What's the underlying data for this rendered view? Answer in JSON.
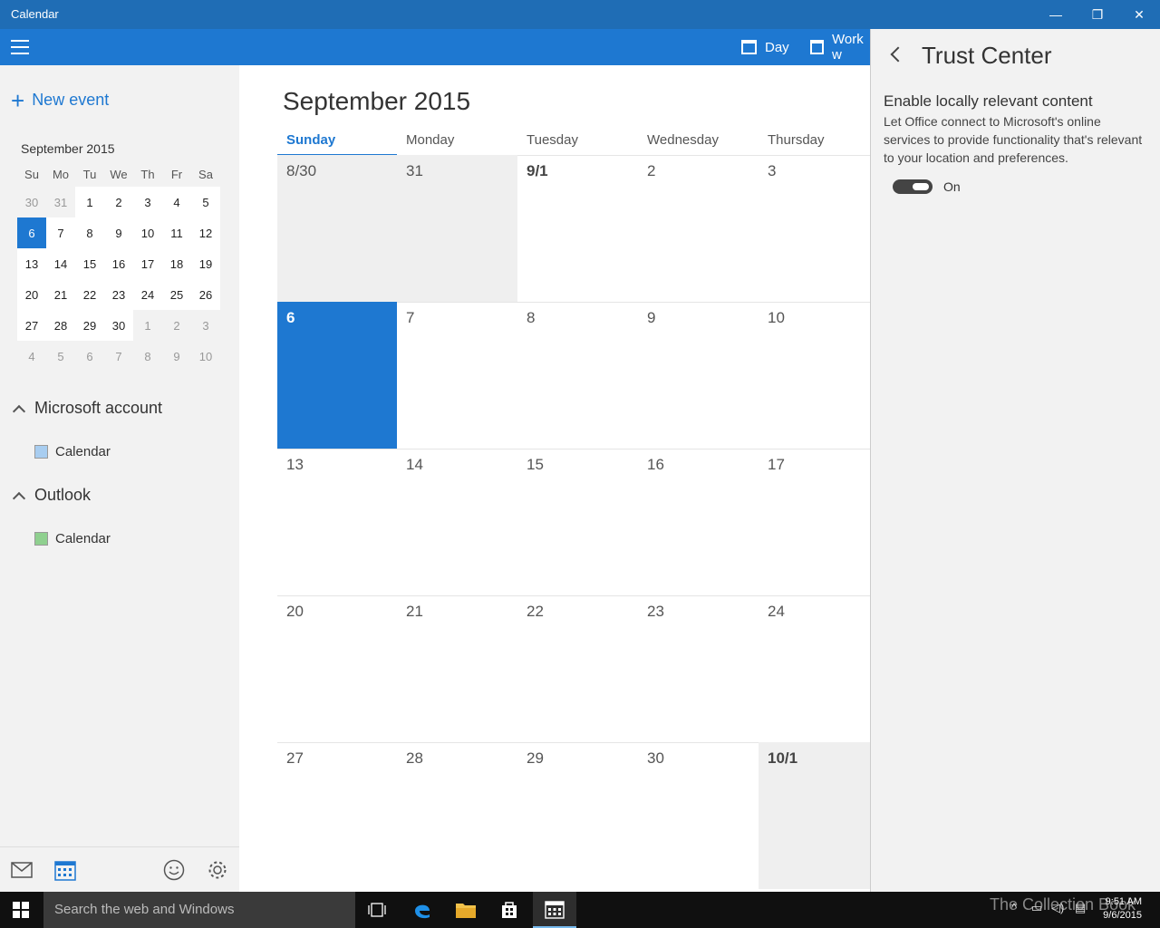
{
  "window": {
    "title": "Calendar",
    "minimize": "—",
    "restore": "❐",
    "close": "✕"
  },
  "toolbar": {
    "day_label": "Day",
    "workweek_label": "Work w"
  },
  "sidebar": {
    "new_event": "New event",
    "mini_month": "September 2015",
    "mini_headers": [
      "Su",
      "Mo",
      "Tu",
      "We",
      "Th",
      "Fr",
      "Sa"
    ],
    "mini_weeks": [
      [
        "30",
        "31",
        "1",
        "2",
        "3",
        "4",
        "5"
      ],
      [
        "6",
        "7",
        "8",
        "9",
        "10",
        "11",
        "12"
      ],
      [
        "13",
        "14",
        "15",
        "16",
        "17",
        "18",
        "19"
      ],
      [
        "20",
        "21",
        "22",
        "23",
        "24",
        "25",
        "26"
      ],
      [
        "27",
        "28",
        "29",
        "30",
        "1",
        "2",
        "3"
      ],
      [
        "4",
        "5",
        "6",
        "7",
        "8",
        "9",
        "10"
      ]
    ],
    "accounts": [
      {
        "name": "Microsoft account",
        "calendar": "Calendar",
        "color": "#a8cdf0"
      },
      {
        "name": "Outlook",
        "calendar": "Calendar",
        "color": "#8fd08f"
      }
    ]
  },
  "main": {
    "month_title": "September 2015",
    "day_headers": [
      "Sunday",
      "Monday",
      "Tuesday",
      "Wednesday",
      "Thursday"
    ],
    "weeks": [
      [
        "8/30",
        "31",
        "9/1",
        "2",
        "3"
      ],
      [
        "6",
        "7",
        "8",
        "9",
        "10"
      ],
      [
        "13",
        "14",
        "15",
        "16",
        "17"
      ],
      [
        "20",
        "21",
        "22",
        "23",
        "24"
      ],
      [
        "27",
        "28",
        "29",
        "30",
        "10/1"
      ]
    ]
  },
  "panel": {
    "title": "Trust Center",
    "setting_heading": "Enable locally relevant content",
    "setting_desc": "Let Office connect to Microsoft's online services to provide functionality that's relevant to your location and preferences.",
    "toggle_label": "On",
    "toggle_on": true
  },
  "taskbar": {
    "search_placeholder": "Search the web and Windows",
    "watermark": "The Collection Book",
    "time": "9:51 AM",
    "date": "9/6/2015"
  },
  "colors": {
    "accent": "#1e78d1",
    "titlebar": "#1f6db5"
  },
  "icons": [
    "hamburger-icon",
    "calendar-icon",
    "mail-icon",
    "smiley-icon",
    "gear-icon",
    "back-icon",
    "windows-icon",
    "edge-icon",
    "folder-icon",
    "store-icon"
  ]
}
